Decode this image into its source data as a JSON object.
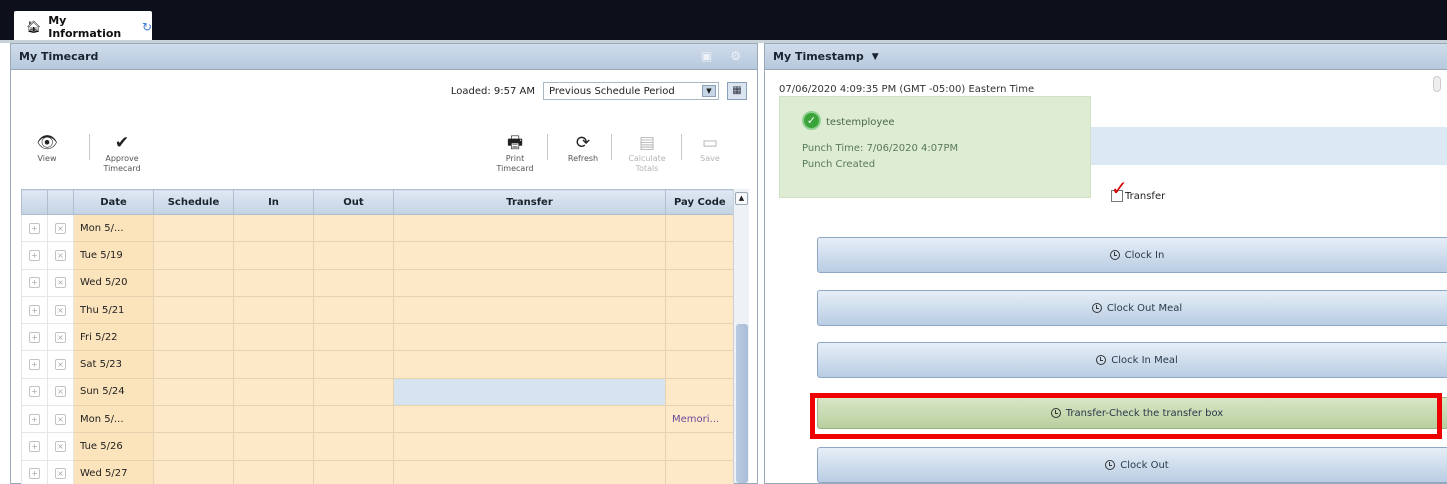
{
  "tab": {
    "label": "My Information",
    "home_icon": "home-icon",
    "refresh_icon": "refresh-icon"
  },
  "timecard": {
    "title": "My Timecard",
    "loaded_text": "Loaded: 9:57 AM",
    "period": "Previous Schedule Period",
    "toolbar": {
      "view": "View",
      "approve": "Approve Timecard",
      "print": "Print Timecard",
      "refresh": "Refresh",
      "calculate": "Calculate Totals",
      "save": "Save"
    },
    "columns": [
      "Date",
      "Schedule",
      "In",
      "Out",
      "Transfer",
      "Pay Code"
    ],
    "rows": [
      {
        "date": "Mon 5/...",
        "paycode": ""
      },
      {
        "date": "Tue 5/19",
        "paycode": ""
      },
      {
        "date": "Wed 5/20",
        "paycode": ""
      },
      {
        "date": "Thu 5/21",
        "paycode": ""
      },
      {
        "date": "Fri 5/22",
        "paycode": ""
      },
      {
        "date": "Sat 5/23",
        "paycode": ""
      },
      {
        "date": "Sun 5/24",
        "paycode": ""
      },
      {
        "date": "Mon 5/...",
        "paycode": "Memori..."
      },
      {
        "date": "Tue 5/26",
        "paycode": ""
      },
      {
        "date": "Wed 5/27",
        "paycode": ""
      }
    ]
  },
  "timestamp": {
    "title": "My Timestamp",
    "datetime": "07/06/2020 4:09:35 PM (GMT -05:00) Eastern Time",
    "notice": {
      "user": "testemployee",
      "punch_time": "Punch Time: 7/06/2020 4:07PM",
      "status": "Punch Created"
    },
    "transfer_label": "Transfer",
    "buttons": {
      "clock_in": "Clock In",
      "clock_out_meal": "Clock Out Meal",
      "clock_in_meal": "Clock In Meal",
      "transfer": "Transfer-Check the transfer box",
      "clock_out": "Clock Out"
    }
  },
  "colors": {
    "highlight": "#ee0000",
    "row_bg": "#fde9c7",
    "header_bg": "#c4d3e4"
  }
}
